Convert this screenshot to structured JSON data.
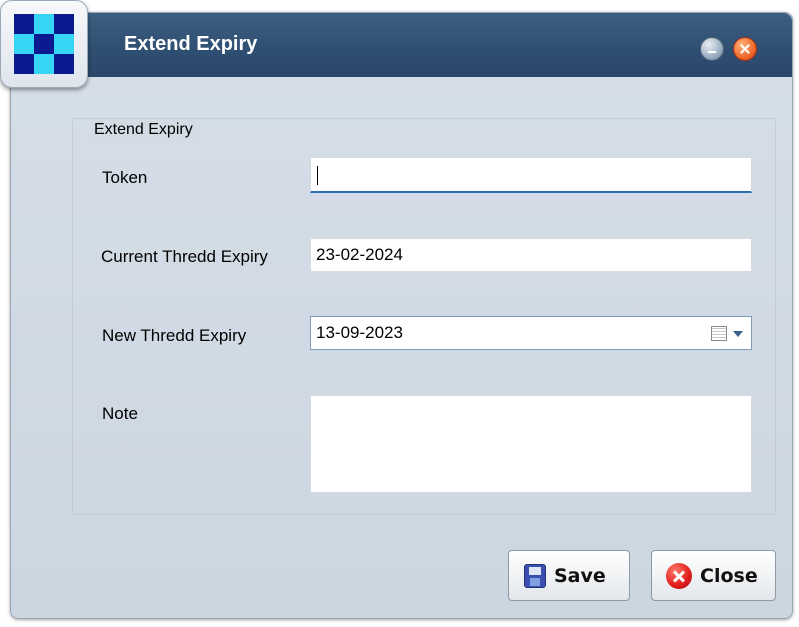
{
  "window": {
    "title": "Extend Expiry",
    "minimize_icon": "minimize-icon",
    "close_icon": "close-icon",
    "app_icon": "checkerboard-app-icon"
  },
  "form": {
    "group_title": "Extend Expiry",
    "token": {
      "label": "Token",
      "value": ""
    },
    "current_expiry": {
      "label": "Current Thredd Expiry",
      "value": "23-02-2024"
    },
    "new_expiry": {
      "label": "New Thredd Expiry",
      "value": "13-09-2023",
      "picker_icon": "calendar-icon"
    },
    "note": {
      "label": "Note",
      "value": ""
    }
  },
  "buttons": {
    "save_label": "Save",
    "save_icon": "floppy-disk-icon",
    "close_label": "Close",
    "close_icon": "red-x-circle-icon"
  },
  "colors": {
    "titlebar": "#2f4f73",
    "window_bg": "#d3dce5",
    "focus_underline": "#2d6fb3"
  }
}
